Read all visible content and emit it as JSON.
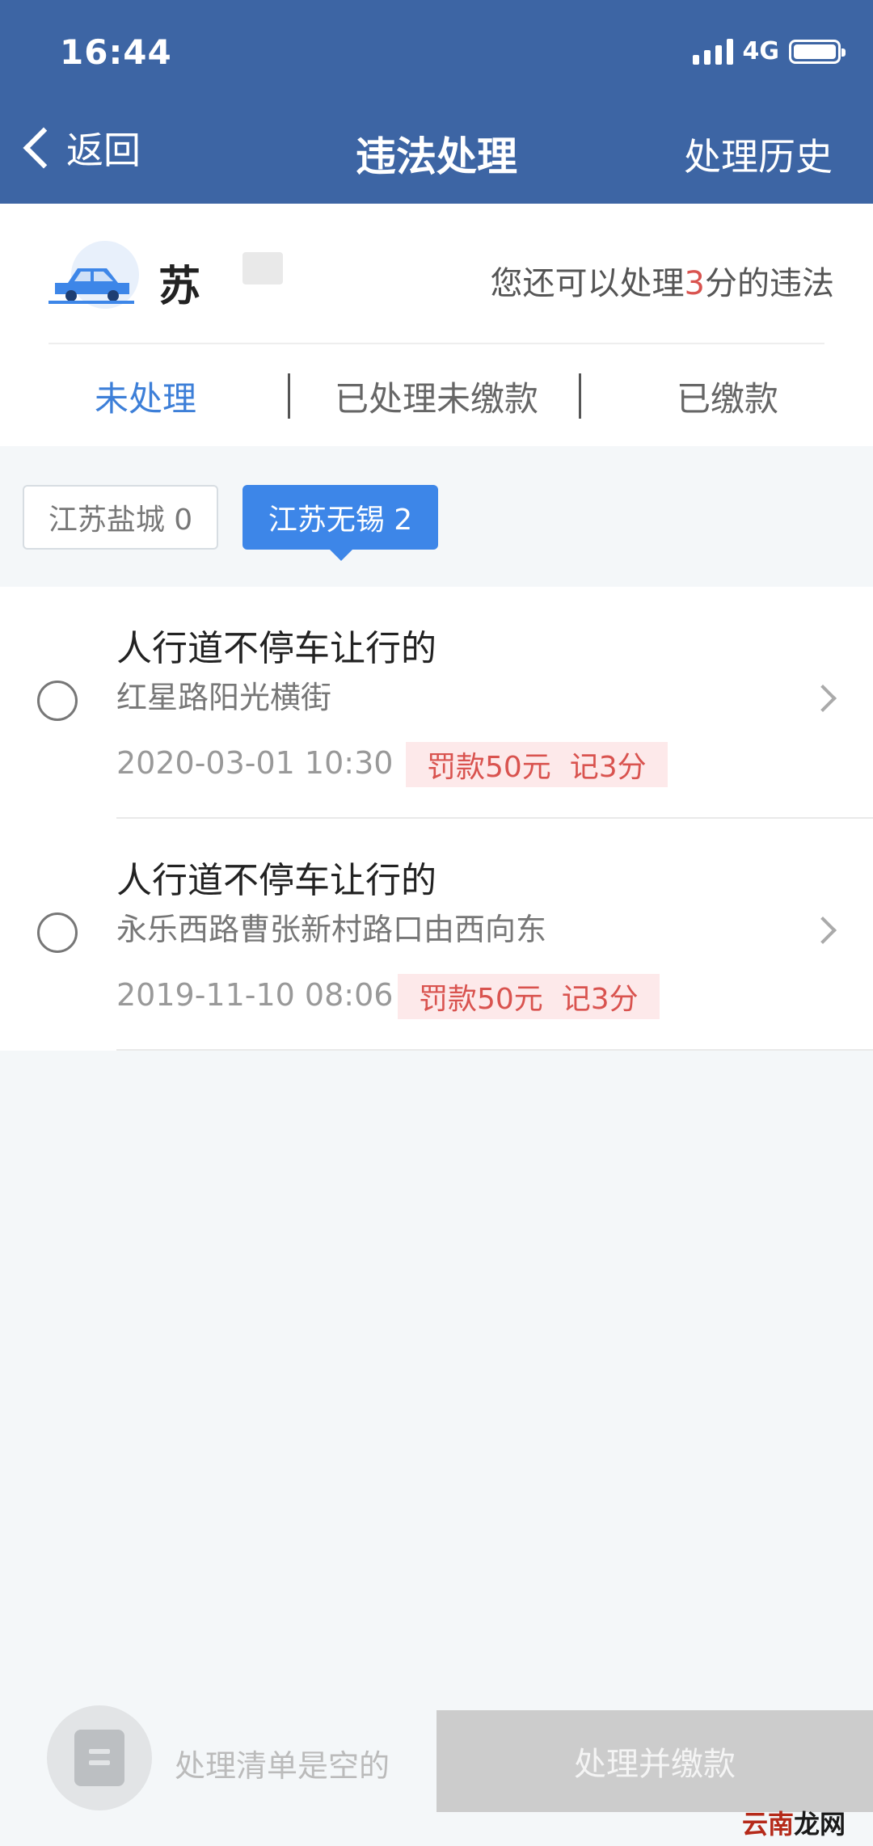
{
  "status_bar": {
    "time": "16:44",
    "network": "4G"
  },
  "nav": {
    "back_label": "返回",
    "title": "违法处理",
    "history_label": "处理历史"
  },
  "plate": {
    "prefix": "苏",
    "points_prefix": "您还可以处理",
    "points_value": "3",
    "points_suffix": "分的违法"
  },
  "tabs": [
    {
      "label": "未处理",
      "active": true
    },
    {
      "label": "已处理未缴款",
      "active": false
    },
    {
      "label": "已缴款",
      "active": false
    }
  ],
  "regions": [
    {
      "label": "江苏盐城 0",
      "selected": false
    },
    {
      "label": "江苏无锡 2",
      "selected": true
    }
  ],
  "violations": [
    {
      "title": "人行道不停车让行的",
      "address": "红星路阳光横街",
      "datetime": "2020-03-01 10:30",
      "fine": "罚款50元",
      "points": "记3分"
    },
    {
      "title": "人行道不停车让行的",
      "address": "永乐西路曹张新村路口由西向东",
      "datetime": "2019-11-10 08:06",
      "fine": "罚款50元",
      "points": "记3分"
    }
  ],
  "bottom": {
    "empty_label": "处理清单是空的",
    "pay_label": "处理并缴款"
  },
  "watermark": {
    "part1": "云南",
    "part2": "龙网"
  },
  "colors": {
    "header": "#3d65a4",
    "accent": "#3d7fd8",
    "chip": "#3d86e8",
    "fine": "#d9534f"
  }
}
